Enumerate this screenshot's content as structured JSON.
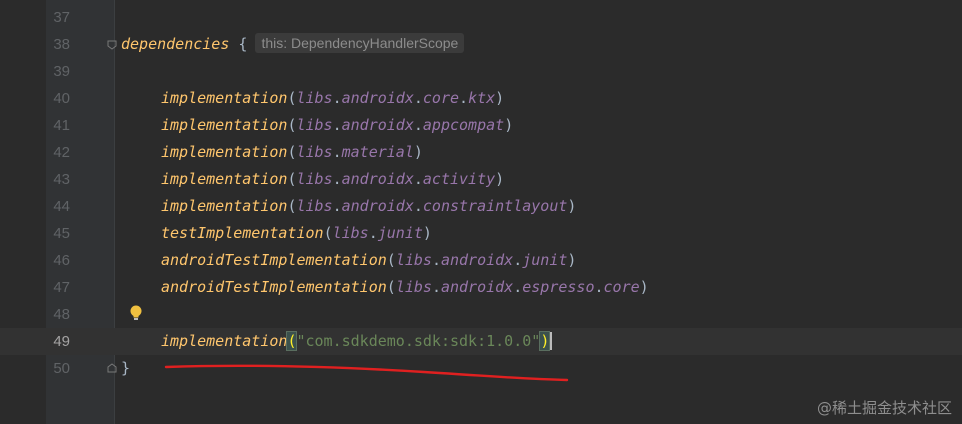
{
  "editor": {
    "lines": [
      {
        "number": "37"
      },
      {
        "number": "38",
        "keyword": "dependencies",
        "brace": "{",
        "hint": "this: DependencyHandlerScope"
      },
      {
        "number": "39"
      },
      {
        "number": "40",
        "fn": "implementation",
        "open": "(",
        "arg_parts": [
          "libs",
          ".",
          "androidx",
          ".",
          "core",
          ".",
          "ktx"
        ],
        "close": ")"
      },
      {
        "number": "41",
        "fn": "implementation",
        "open": "(",
        "arg_parts": [
          "libs",
          ".",
          "androidx",
          ".",
          "appcompat"
        ],
        "close": ")"
      },
      {
        "number": "42",
        "fn": "implementation",
        "open": "(",
        "arg_parts": [
          "libs",
          ".",
          "material"
        ],
        "close": ")"
      },
      {
        "number": "43",
        "fn": "implementation",
        "open": "(",
        "arg_parts": [
          "libs",
          ".",
          "androidx",
          ".",
          "activity"
        ],
        "close": ")"
      },
      {
        "number": "44",
        "fn": "implementation",
        "open": "(",
        "arg_parts": [
          "libs",
          ".",
          "androidx",
          ".",
          "constraintlayout"
        ],
        "close": ")"
      },
      {
        "number": "45",
        "fn": "testImplementation",
        "open": "(",
        "arg_parts": [
          "libs",
          ".",
          "junit"
        ],
        "close": ")"
      },
      {
        "number": "46",
        "fn": "androidTestImplementation",
        "open": "(",
        "arg_parts": [
          "libs",
          ".",
          "androidx",
          ".",
          "junit"
        ],
        "close": ")"
      },
      {
        "number": "47",
        "fn": "androidTestImplementation",
        "open": "(",
        "arg_parts": [
          "libs",
          ".",
          "androidx",
          ".",
          "espresso",
          ".",
          "core"
        ],
        "close": ")"
      },
      {
        "number": "48"
      },
      {
        "number": "49",
        "fn": "implementation",
        "open": "(",
        "string": "\"com.sdkdemo.sdk:sdk:1.0.0\"",
        "close": ")"
      },
      {
        "number": "50",
        "brace": "}"
      }
    ],
    "current_line": "49",
    "icons": {
      "intention": "lightbulb-icon",
      "fold": "fold-marker-icon"
    },
    "colors": {
      "background": "#2b2b2b",
      "gutter": "#313335",
      "function": "#ffc66d",
      "property": "#9876aa",
      "string": "#6a8759",
      "annotation_underline": "#e02020"
    }
  },
  "watermark": "@稀土掘金技术社区"
}
